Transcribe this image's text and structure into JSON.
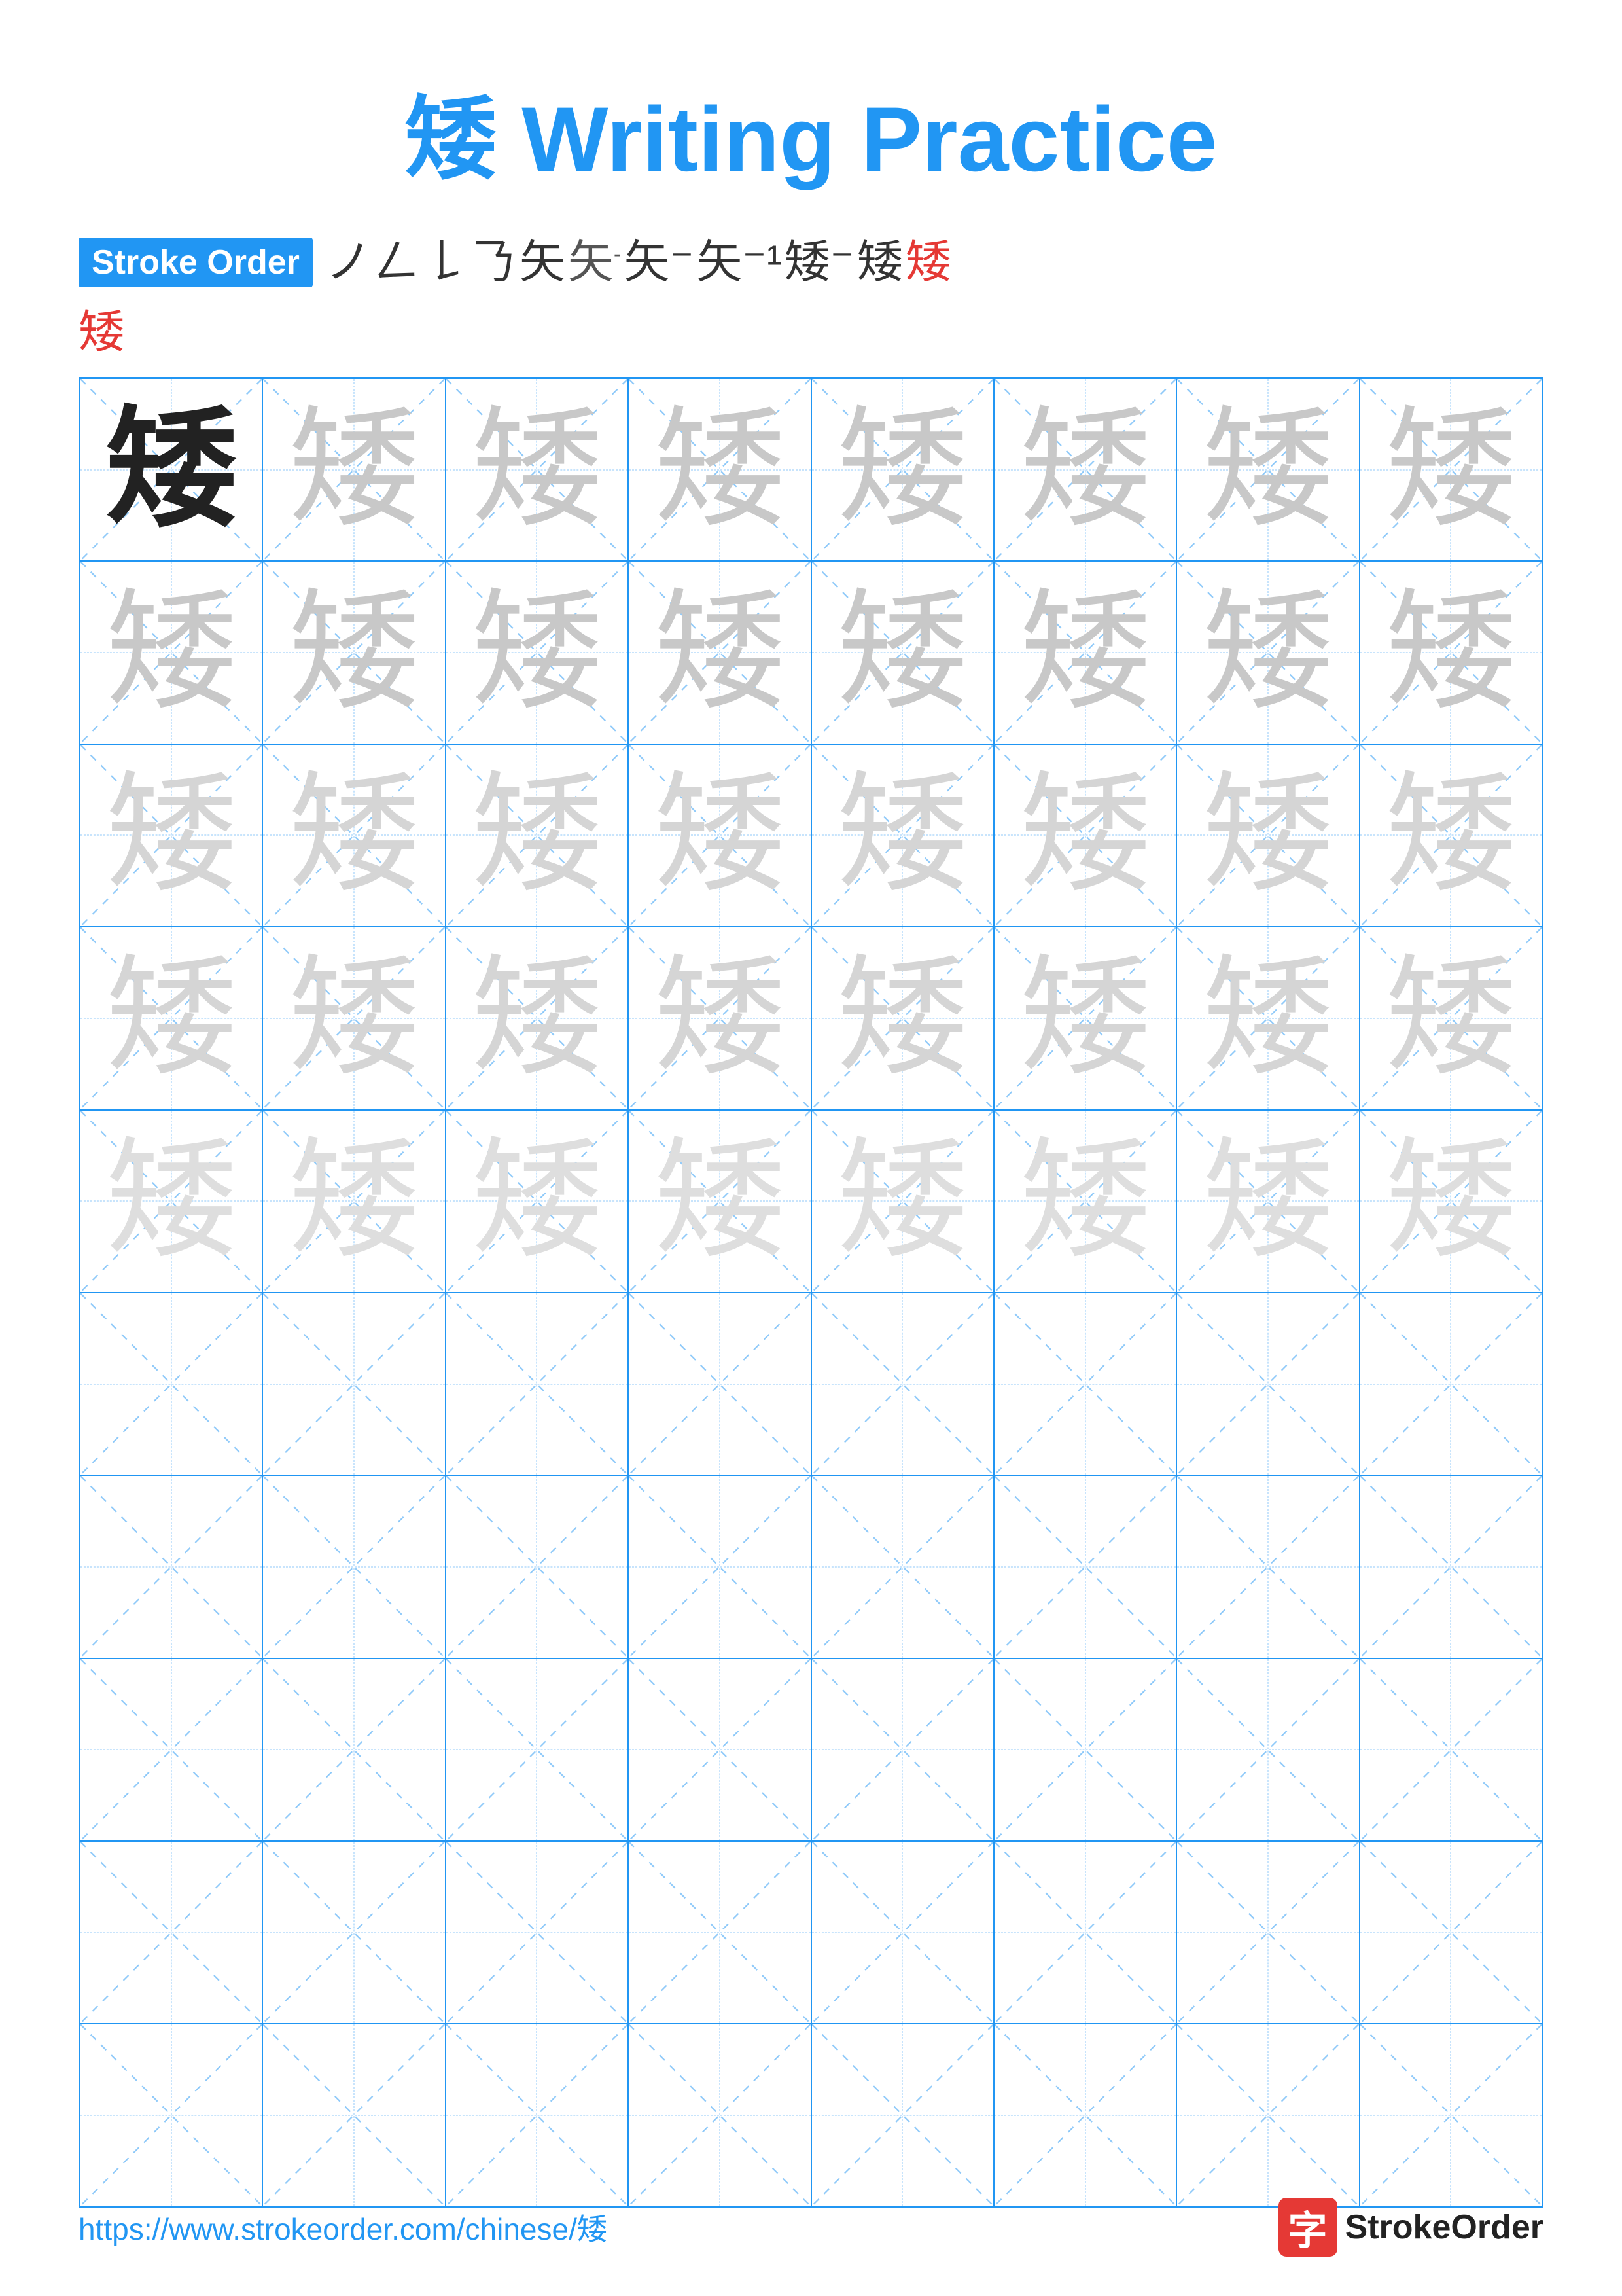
{
  "title": "矮 Writing Practice",
  "stroke_order_label": "Stroke Order",
  "stroke_order_chars": [
    "'",
    "𠃋",
    "𠃌",
    "𠄌",
    "矢",
    "矢⁻",
    "矢⁻",
    "矢⁻¹",
    "矢⁻¹",
    "矮⁻",
    "矮⁻",
    "矮"
  ],
  "character": "矮",
  "grid_rows": 10,
  "grid_cols": 8,
  "footer_url": "https://www.strokeorder.com/chinese/矮",
  "footer_logo_char": "字",
  "footer_logo_text": "StrokeOrder",
  "colors": {
    "primary": "#2196F3",
    "accent": "#e53935",
    "dark_char": "#222222",
    "light1": "#C8C8C8",
    "light2": "#D0D0D0",
    "light3": "#DEDEDE",
    "dashed_line": "#90CAF9"
  }
}
